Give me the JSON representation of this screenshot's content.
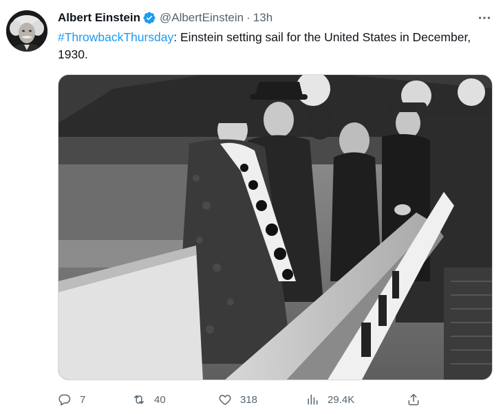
{
  "author": {
    "display_name": "Albert Einstein",
    "handle": "@AlbertEinstein",
    "separator": "·",
    "time": "13h",
    "verified_icon": "verified-badge-icon"
  },
  "tweet": {
    "hashtag": "#ThrowbackThursday",
    "text_after_hashtag": ": Einstein setting sail for the United States in December, 1930."
  },
  "media": {
    "kind": "black-and-white photograph",
    "icon": "photo"
  },
  "actions": {
    "reply_count": "7",
    "retweet_count": "40",
    "like_count": "318",
    "views_count": "29.4K"
  },
  "colors": {
    "link": "#1d9bf0",
    "secondary_text": "#536471",
    "primary_text": "#0f1419",
    "verified": "#1d9bf0"
  },
  "icons": {
    "more": "more-horizontal-icon",
    "reply": "reply-icon",
    "retweet": "retweet-icon",
    "like": "heart-icon",
    "views": "bar-chart-icon",
    "share": "share-icon"
  }
}
